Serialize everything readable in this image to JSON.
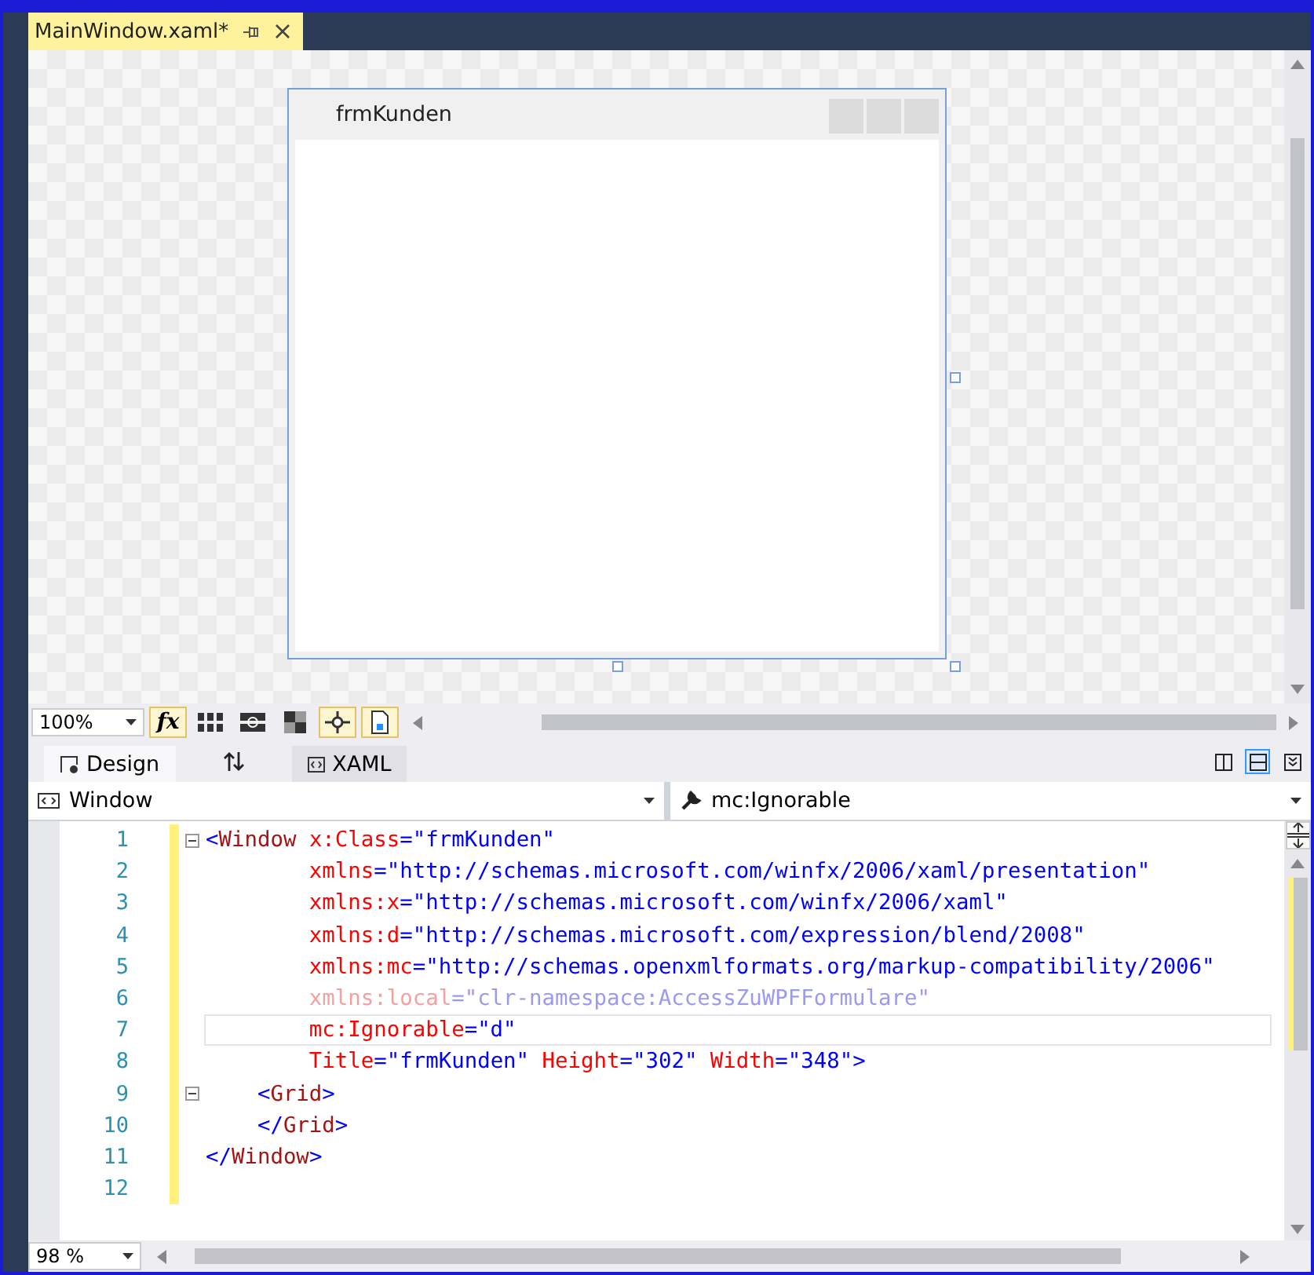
{
  "document_tab": {
    "title": "MainWindow.xaml*",
    "selected": true
  },
  "designer": {
    "window_title": "frmKunden"
  },
  "designer_toolbar": {
    "zoom": "100%",
    "buttons": [
      {
        "kind": "fx",
        "label": "fx",
        "on": true
      },
      {
        "kind": "grid",
        "on": false
      },
      {
        "kind": "snapgrid",
        "on": false
      },
      {
        "kind": "background",
        "on": false
      },
      {
        "kind": "snaplines",
        "on": true
      },
      {
        "kind": "effects",
        "on": true
      }
    ]
  },
  "view_tabs": [
    {
      "kind": "design",
      "label": "Design",
      "selected": true
    },
    {
      "kind": "swap"
    },
    {
      "kind": "xaml",
      "label": "XAML",
      "selected": false
    }
  ],
  "pane_buttons": [
    {
      "kind": "vertical",
      "selected": false
    },
    {
      "kind": "horizontal",
      "selected": true
    },
    {
      "kind": "collapse",
      "selected": false
    }
  ],
  "breadcrumbs": {
    "element": "Window",
    "member": "mc:Ignorable"
  },
  "code_lines": [
    {
      "number": "1",
      "fold": true,
      "current": false,
      "tokens": [
        {
          "kind": "punct",
          "text": "<"
        },
        {
          "kind": "tag",
          "text": "Window"
        },
        {
          "kind": "attr",
          "text": " x:Class"
        },
        {
          "kind": "punct",
          "text": "="
        },
        {
          "kind": "value",
          "text": "\"frmKunden\""
        }
      ]
    },
    {
      "number": "2",
      "fold": false,
      "current": false,
      "tokens": [
        {
          "kind": "attr",
          "text": "        xmlns"
        },
        {
          "kind": "punct",
          "text": "="
        },
        {
          "kind": "value",
          "text": "\"http://schemas.microsoft.com/winfx/2006/xaml/presentation\""
        }
      ]
    },
    {
      "number": "3",
      "fold": false,
      "current": false,
      "tokens": [
        {
          "kind": "attr",
          "text": "        xmlns:x"
        },
        {
          "kind": "punct",
          "text": "="
        },
        {
          "kind": "value",
          "text": "\"http://schemas.microsoft.com/winfx/2006/xaml\""
        }
      ]
    },
    {
      "number": "4",
      "fold": false,
      "current": false,
      "tokens": [
        {
          "kind": "attr",
          "text": "        xmlns:d"
        },
        {
          "kind": "punct",
          "text": "="
        },
        {
          "kind": "value",
          "text": "\"http://schemas.microsoft.com/expression/blend/2008\""
        }
      ]
    },
    {
      "number": "5",
      "fold": false,
      "current": false,
      "tokens": [
        {
          "kind": "attr",
          "text": "        xmlns:mc"
        },
        {
          "kind": "punct",
          "text": "="
        },
        {
          "kind": "value",
          "text": "\"http://schemas.openxmlformats.org/markup-compatibility/2006\""
        }
      ]
    },
    {
      "number": "6",
      "fold": false,
      "current": false,
      "tokens": [
        {
          "kind": "unused_attr",
          "text": "        xmlns:local"
        },
        {
          "kind": "unused_punct",
          "text": "="
        },
        {
          "kind": "unused_value",
          "text": "\"clr-namespace:AccessZuWPFFormulare\""
        }
      ]
    },
    {
      "number": "7",
      "fold": false,
      "current": true,
      "tokens": [
        {
          "kind": "attr",
          "text": "        mc:Ignorable"
        },
        {
          "kind": "punct",
          "text": "="
        },
        {
          "kind": "value",
          "text": "\"d\""
        }
      ]
    },
    {
      "number": "8",
      "fold": false,
      "current": false,
      "tokens": [
        {
          "kind": "attr",
          "text": "        Title"
        },
        {
          "kind": "punct",
          "text": "="
        },
        {
          "kind": "value",
          "text": "\"frmKunden\""
        },
        {
          "kind": "attr",
          "text": " Height"
        },
        {
          "kind": "punct",
          "text": "="
        },
        {
          "kind": "value",
          "text": "\"302\""
        },
        {
          "kind": "attr",
          "text": " Width"
        },
        {
          "kind": "punct",
          "text": "="
        },
        {
          "kind": "value",
          "text": "\"348\""
        },
        {
          "kind": "punct",
          "text": ">"
        }
      ]
    },
    {
      "number": "9",
      "fold": true,
      "current": false,
      "tokens": [
        {
          "kind": "punct",
          "text": "    <"
        },
        {
          "kind": "tag",
          "text": "Grid"
        },
        {
          "kind": "punct",
          "text": ">"
        }
      ]
    },
    {
      "number": "10",
      "fold": false,
      "current": false,
      "tokens": [
        {
          "kind": "punct",
          "text": "    </"
        },
        {
          "kind": "tag",
          "text": "Grid"
        },
        {
          "kind": "punct",
          "text": ">"
        }
      ]
    },
    {
      "number": "11",
      "fold": false,
      "current": false,
      "tokens": [
        {
          "kind": "punct",
          "text": "</"
        },
        {
          "kind": "tag",
          "text": "Window"
        },
        {
          "kind": "punct",
          "text": ">"
        }
      ]
    },
    {
      "number": "12",
      "fold": false,
      "current": false
    }
  ],
  "code_zoom": "98 %"
}
